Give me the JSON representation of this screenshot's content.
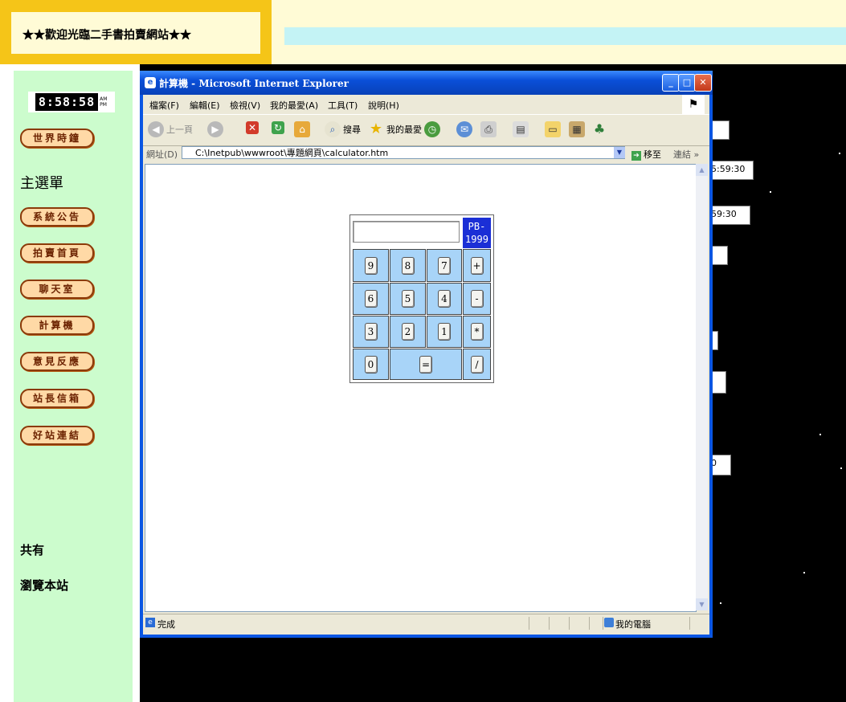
{
  "header": {
    "site_title": "★★歡迎光臨二手書拍賣網站★★"
  },
  "sidebar": {
    "clock": {
      "digits": "8:58:58",
      "ampm": "AM PM"
    },
    "world_clock": "世界時鐘",
    "menu_heading": "主選單",
    "menu_items": [
      "系統公告",
      "拍賣首頁",
      "聊天室",
      "計算機",
      "意見反應",
      "站長信箱",
      "好站連結"
    ],
    "total_label": "共有",
    "visits_label": "瀏覽本站"
  },
  "background_fields": [
    " ",
    "5:59:30",
    "59:30",
    " ",
    " ",
    " ",
    "0"
  ],
  "ie": {
    "title": "計算機 - Microsoft Internet Explorer",
    "menu": [
      "檔案(F)",
      "編輯(E)",
      "檢視(V)",
      "我的最愛(A)",
      "工具(T)",
      "說明(H)"
    ],
    "toolbar": {
      "back": "上一頁",
      "search": "搜尋",
      "favorites": "我的最愛"
    },
    "address_label": "網址(D)",
    "address": "C:\\Inetpub\\wwwroot\\專題網頁\\calculator.htm",
    "go": "移至",
    "links": "連結",
    "status": "完成",
    "zone": "我的電腦"
  },
  "calculator": {
    "display": "",
    "brand": [
      "PB-",
      "1999"
    ],
    "keys": [
      "9",
      "8",
      "7",
      "+",
      "6",
      "5",
      "4",
      "-",
      "3",
      "2",
      "1",
      "*",
      "0",
      "=",
      "/"
    ]
  }
}
